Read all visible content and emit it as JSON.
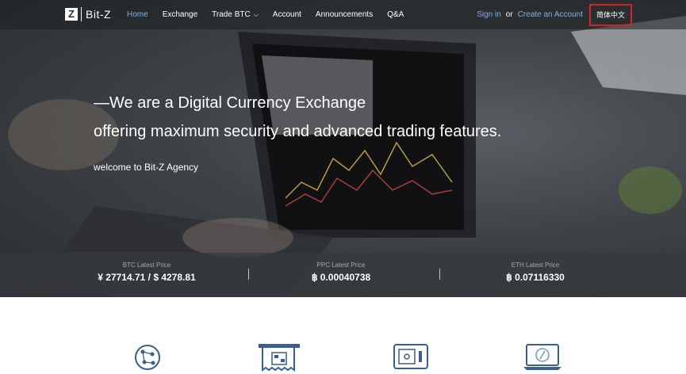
{
  "brand": {
    "logo_mark": "Z",
    "name": "Bit-Z"
  },
  "nav": {
    "items": [
      "Home",
      "Exchange",
      "Trade BTC",
      "Account",
      "Announcements",
      "Q&A"
    ],
    "sign_in": "Sign in",
    "or": "or",
    "create_account": "Create an Account",
    "language": "简体中文"
  },
  "hero": {
    "headline_1": "—We are a Digital Currency Exchange",
    "headline_2": "offering maximum security and advanced trading features.",
    "welcome": "welcome to Bit-Z Agency"
  },
  "prices": [
    {
      "label": "BTC Latest Price",
      "value": "¥ 27714.71 / $ 4278.81"
    },
    {
      "label": "PPC Latest Price",
      "value": "฿ 0.00040738"
    },
    {
      "label": "ETH Latest Price",
      "value": "฿ 0.07116330"
    }
  ],
  "features": [
    "network-icon",
    "qr-payment-icon",
    "safe-icon",
    "laptop-bitcoin-icon"
  ],
  "colors": {
    "accent": "#7fb1e6",
    "highlight_border": "#d0262a"
  }
}
